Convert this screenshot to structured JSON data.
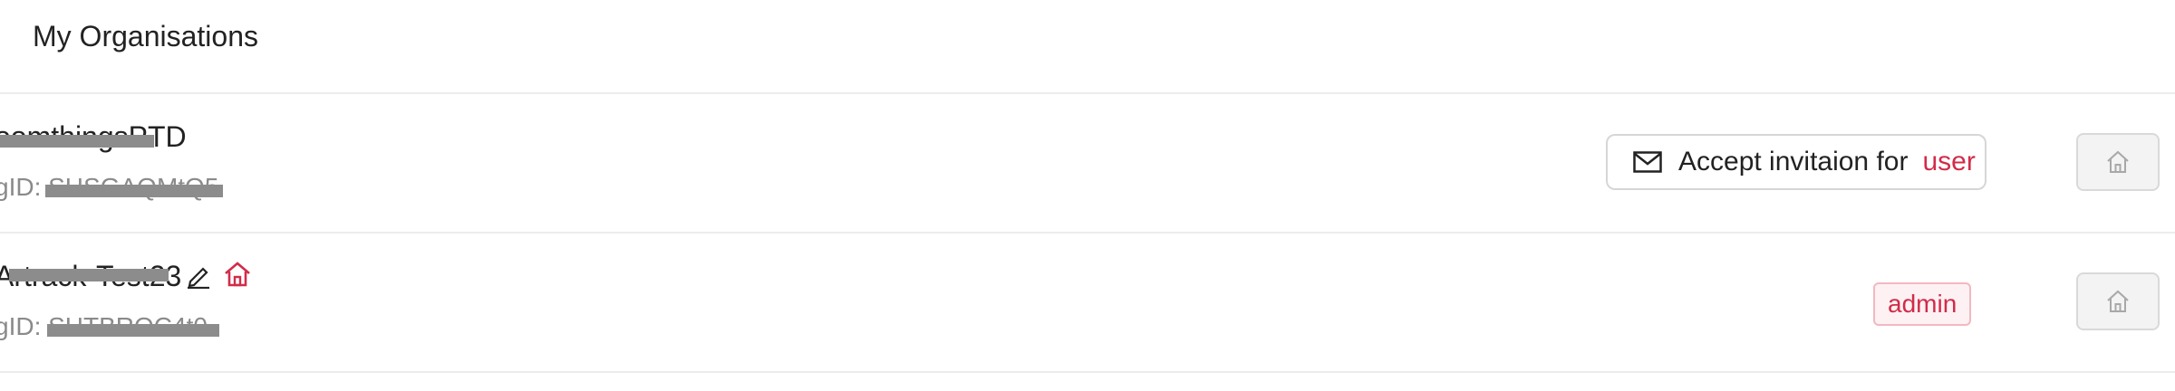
{
  "header": {
    "title": "My Organisations"
  },
  "organisations": [
    {
      "name": "oomthingsPTD",
      "org_id_label": "gID: SHSGAQMtQ5",
      "action": {
        "prefix": "Accept invitaion for",
        "role": "user"
      }
    },
    {
      "name": "Artrack-Test23",
      "org_id_label": "gID: SHTBROC4t0",
      "role_badge": "admin"
    }
  ],
  "colors": {
    "accent": "#d12c49",
    "muted": "#8a8a8a",
    "border": "#d6d6d6"
  },
  "icons": [
    "mail-icon",
    "edit-icon",
    "home-icon"
  ]
}
